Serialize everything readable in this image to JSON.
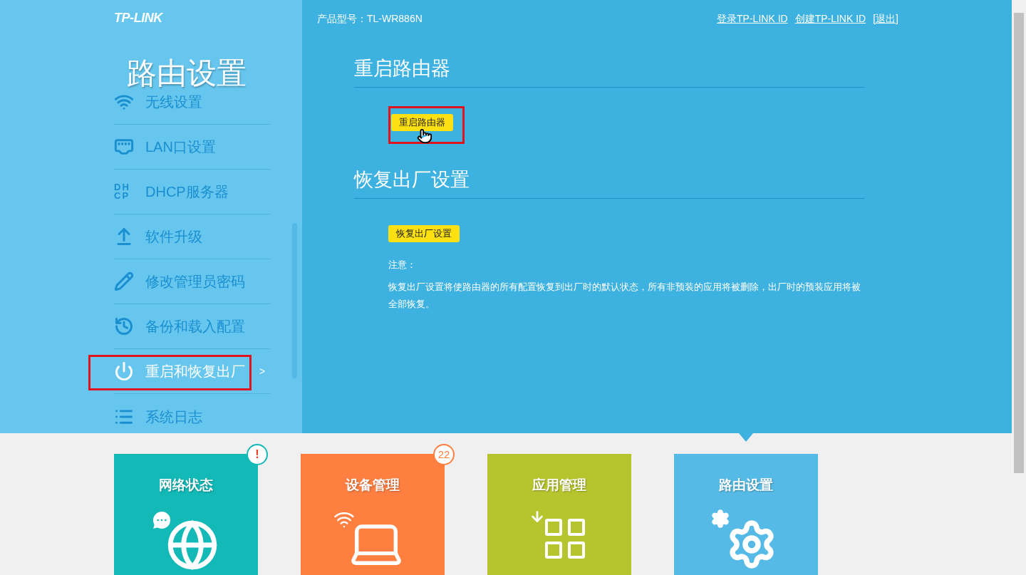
{
  "header": {
    "logo": "TP-LINK",
    "model": "产品型号：TL-WR886N",
    "links": [
      "登录TP-LINK ID",
      "创建TP-LINK ID",
      "[退出]"
    ]
  },
  "sidebar": {
    "title": "路由设置",
    "items": [
      {
        "kind": "wifi",
        "label": "无线设置",
        "selected": false
      },
      {
        "kind": "lan",
        "label": "LAN口设置",
        "selected": false
      },
      {
        "kind": "dhcp",
        "icon_text": [
          "DH",
          "CP"
        ],
        "label": "DHCP服务器",
        "selected": false
      },
      {
        "kind": "upgrade",
        "label": "软件升级",
        "selected": false
      },
      {
        "kind": "password",
        "label": "修改管理员密码",
        "selected": false
      },
      {
        "kind": "backup",
        "label": "备份和载入配置",
        "selected": false
      },
      {
        "kind": "power",
        "label": "重启和恢复出厂",
        "selected": true,
        "highlighted": true,
        "arrow": ">"
      },
      {
        "kind": "log",
        "label": "系统日志",
        "selected": false
      }
    ]
  },
  "sections": [
    {
      "title": "重启路由器",
      "button": "重启路由器",
      "highlighted": true,
      "cursor": true
    },
    {
      "title": "恢复出厂设置",
      "button": "恢复出厂设置",
      "highlighted": false,
      "cursor": false,
      "note_title": "注意：",
      "note": "恢复出厂设置将使路由器的所有配置恢复到出厂时的默认状态，所有非预装的应用将被删除，出厂时的预装应用将被全部恢复。"
    }
  ],
  "tiles": [
    {
      "kind": "network",
      "title": "网络状态",
      "color": "#12b9b7",
      "badge": {
        "kind": "alert",
        "text": "!"
      },
      "selected": false
    },
    {
      "kind": "devices",
      "title": "设备管理",
      "color": "#fe7f40",
      "badge": {
        "kind": "count",
        "text": "22"
      },
      "selected": false
    },
    {
      "kind": "apps",
      "title": "应用管理",
      "color": "#b6c52d",
      "selected": false
    },
    {
      "kind": "router",
      "title": "路由设置",
      "color": "#55bbe6",
      "selected": true
    }
  ]
}
